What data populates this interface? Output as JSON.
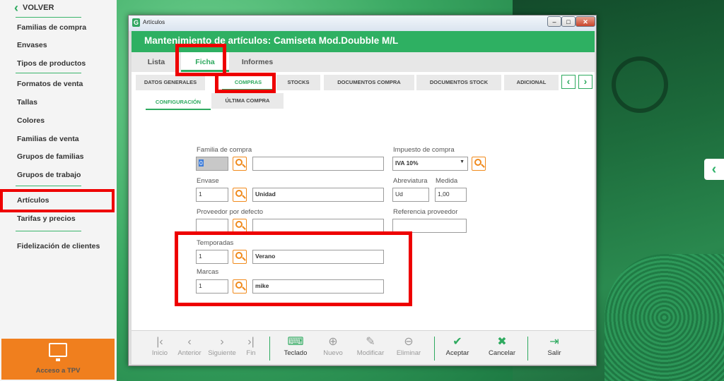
{
  "sidebar": {
    "back_label": "VOLVER",
    "items": [
      "Familias de compra",
      "Envases",
      "Tipos de productos",
      "Formatos de venta",
      "Tallas",
      "Colores",
      "Familias de venta",
      "Grupos de familias",
      "Grupos de trabajo",
      "Artículos",
      "Tarifas y precios",
      "Fidelización de clientes"
    ],
    "tpv_label": "Acceso a TPV"
  },
  "window": {
    "title": "Artículos",
    "header": "Mantenimiento de artículos: Camiseta Mod.Doubble M/L",
    "main_tabs": [
      "Lista",
      "Ficha",
      "Informes"
    ],
    "sub_tabs": [
      "DATOS GENERALES",
      "COMPRAS",
      "STOCKS",
      "DOCUMENTOS COMPRA",
      "DOCUMENTOS STOCK",
      "ADICIONAL"
    ],
    "sub_tabs2": [
      "CONFIGURACIÓN",
      "ÚLTIMA COMPRA"
    ]
  },
  "form": {
    "familia_label": "Familia de compra",
    "familia_code": "0",
    "familia_desc": "",
    "impuesto_label": "Impuesto de compra",
    "impuesto_value": "IVA 10%",
    "envase_label": "Envase",
    "envase_code": "1",
    "envase_desc": "Unidad",
    "abrev_label": "Abreviatura",
    "abrev_value": "Ud",
    "medida_label": "Medida",
    "medida_value": "1,00",
    "proveedor_label": "Proveedor por defecto",
    "proveedor_code": "",
    "proveedor_desc": "",
    "ref_label": "Referencia proveedor",
    "ref_value": "",
    "temporadas_label": "Temporadas",
    "temporadas_code": "1",
    "temporadas_desc": "Verano",
    "marcas_label": "Marcas",
    "marcas_code": "1",
    "marcas_desc": "mike"
  },
  "toolbar": {
    "inicio": "Inicio",
    "anterior": "Anterior",
    "siguiente": "Siguiente",
    "fin": "Fin",
    "teclado": "Teclado",
    "nuevo": "Nuevo",
    "modificar": "Modificar",
    "eliminar": "Eliminar",
    "aceptar": "Aceptar",
    "cancelar": "Cancelar",
    "salir": "Salir"
  },
  "colors": {
    "accent": "#2eb062",
    "highlight": "#e00000",
    "tpv": "#f07f1e",
    "search": "#f08a1c"
  }
}
